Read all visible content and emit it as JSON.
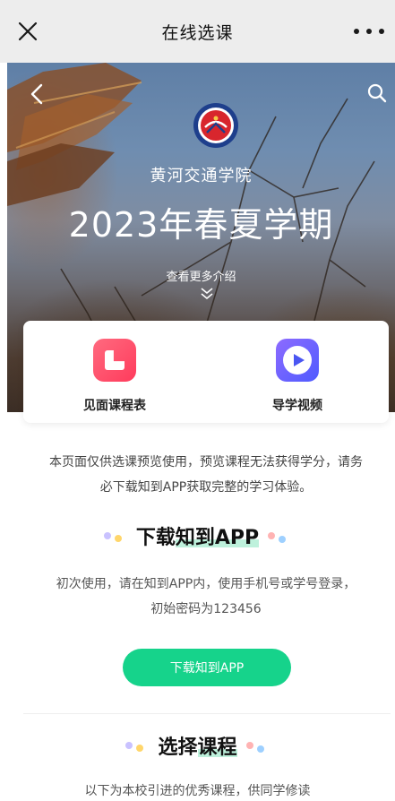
{
  "nav": {
    "title": "在线选课",
    "icons": [
      "close-icon",
      "more-icon"
    ]
  },
  "hero": {
    "school": "黄河交通学院",
    "term": "2023年春夏学期",
    "more": "查看更多介绍",
    "icons": [
      "back-icon",
      "search-icon",
      "school-logo",
      "chevron-double-down-icon"
    ]
  },
  "entries": [
    {
      "label": "见面课程表",
      "icon": "schedule-icon"
    },
    {
      "label": "导学视频",
      "icon": "video-play-icon"
    }
  ],
  "notice": "本页面仅供选课预览使用，预览课程无法获得学分，请务必下载知到APP获取完整的学习体验。",
  "download": {
    "title_prefix": "下载",
    "title_highlight": "知到APP",
    "desc": "初次使用，请在知到APP内，使用手机号或学号登录，初始密码为123456",
    "button": "下载知到APP"
  },
  "select": {
    "title_prefix": "选择",
    "title_highlight": "课程",
    "intro": "以下为本校引进的优秀课程，供同学修读"
  },
  "colors": {
    "accent_green": "#16d38b",
    "schedule_red": "#ff3b5c",
    "video_purple": "#6a5cff"
  }
}
